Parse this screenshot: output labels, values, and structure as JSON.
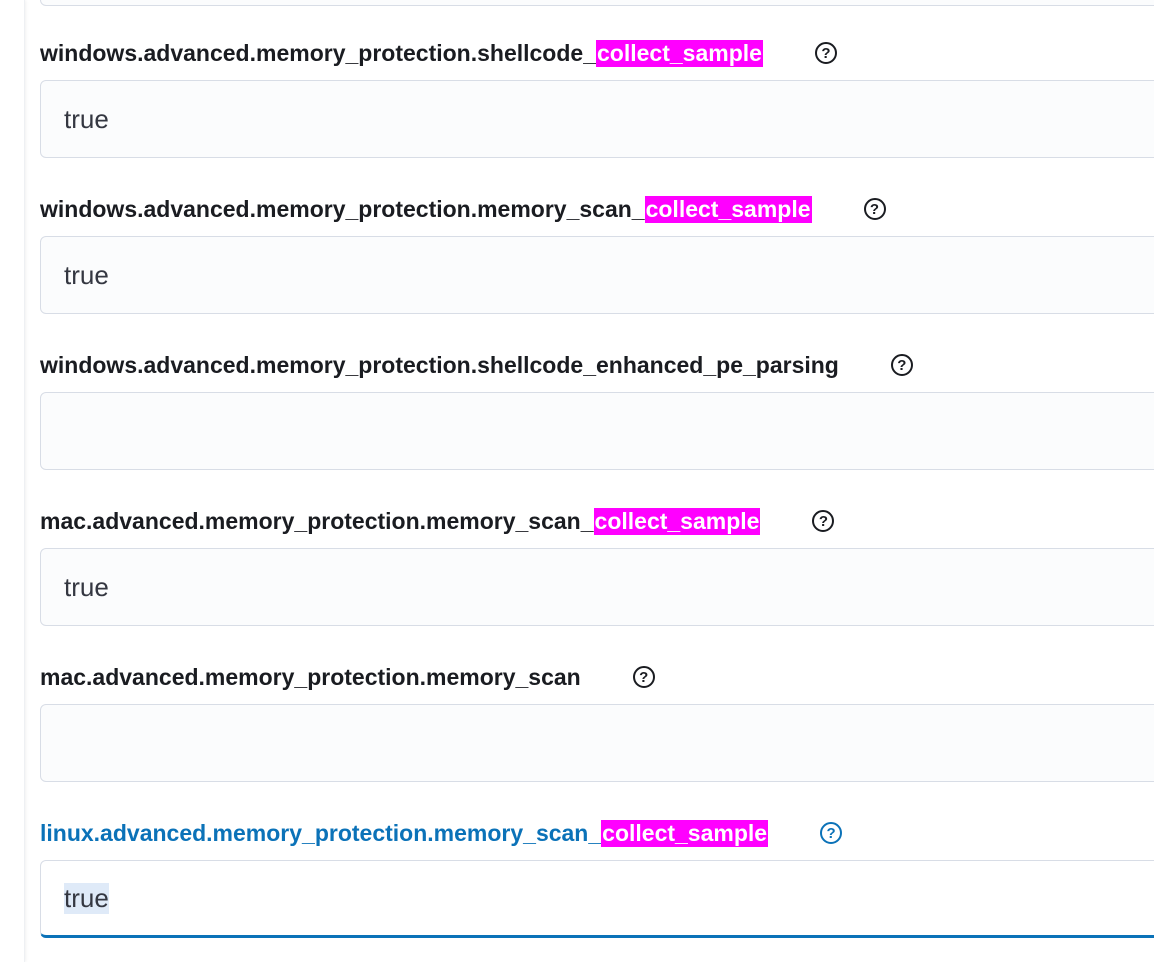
{
  "settings": [
    {
      "label_prefix": "windows.advanced.memory_protection.shellcode_",
      "label_highlight": "collect_sample",
      "value": "true",
      "active": false
    },
    {
      "label_prefix": "windows.advanced.memory_protection.memory_scan_",
      "label_highlight": "collect_sample",
      "value": "true",
      "active": false
    },
    {
      "label_prefix": "windows.advanced.memory_protection.shellcode_enhanced_pe_parsing",
      "label_highlight": "",
      "value": "",
      "active": false
    },
    {
      "label_prefix": "mac.advanced.memory_protection.memory_scan_",
      "label_highlight": "collect_sample",
      "value": "true",
      "active": false
    },
    {
      "label_prefix": "mac.advanced.memory_protection.memory_scan",
      "label_highlight": "",
      "value": "",
      "active": false
    },
    {
      "label_prefix": "linux.advanced.memory_protection.memory_scan_",
      "label_highlight": "collect_sample",
      "value": "true",
      "active": true
    }
  ],
  "help_icon_glyph": "?",
  "colors": {
    "highlight": "#ff00ff",
    "active": "#0b72b8",
    "label": "#1a1c21"
  }
}
